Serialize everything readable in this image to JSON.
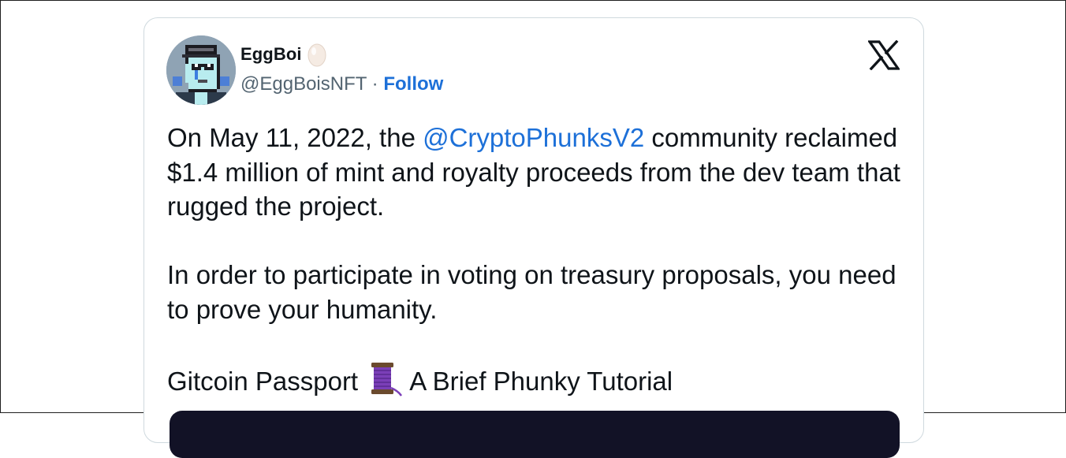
{
  "tweet": {
    "author_name": "EggBoi",
    "author_emoji": "🥚",
    "handle": "@EggBoisNFT",
    "separator": "·",
    "follow_label": "Follow",
    "body": {
      "p1_before": "On May 11, 2022, the ",
      "p1_mention": "@CryptoPhunksV2",
      "p1_after": " community reclaimed $1.4 million of mint and royalty proceeds from the dev team that rugged the project.",
      "p2": "In order to participate in voting on treasury proposals, you need to prove your humanity.",
      "p3_before": "Gitcoin Passport",
      "p3_emoji": "🧵",
      "p3_after": "A Brief Phunky Tutorial"
    }
  },
  "icons": {
    "avatar": "pixel-punk-avatar",
    "emoji_after_name": "egg-icon",
    "platform_logo": "x-logo-icon",
    "thread_emoji": "spool-of-thread-icon"
  },
  "colors": {
    "link": "#1d70d8",
    "text": "#0f1419",
    "secondary_text": "#536471",
    "card_border": "#cfd9de",
    "media_background": "#121226"
  }
}
